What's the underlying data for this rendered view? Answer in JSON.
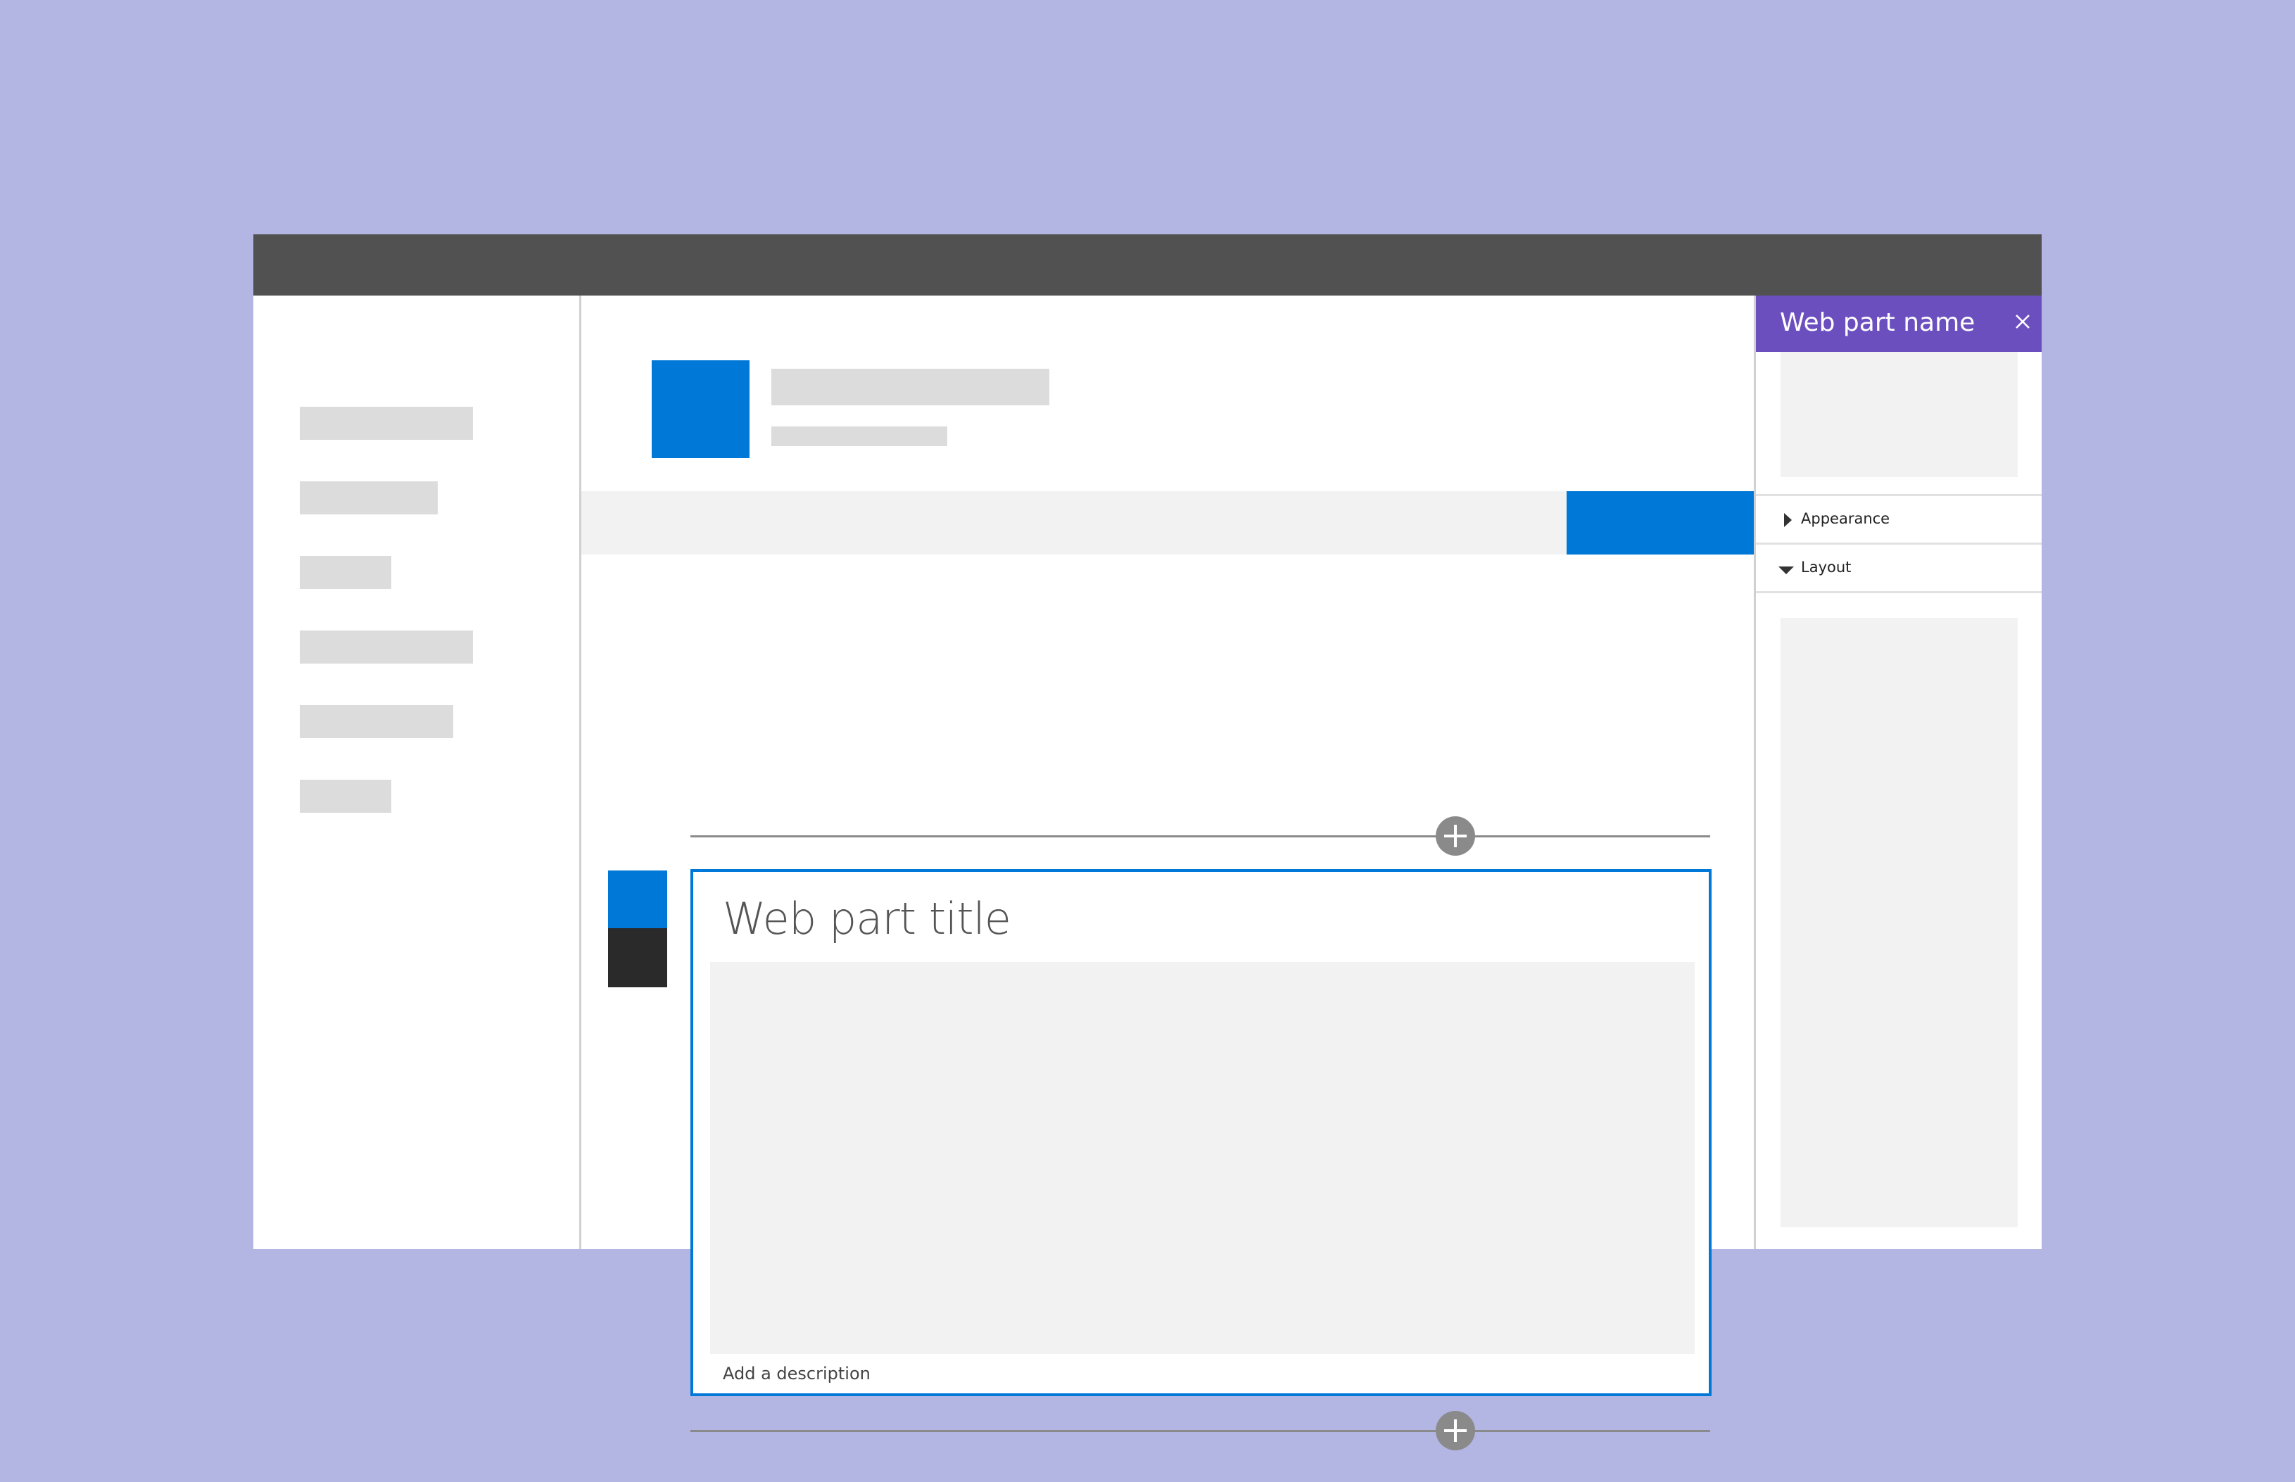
{
  "window": {
    "accent_color": "#0078d7",
    "pane_header_color": "#6b4fbf",
    "frame_color": "#515151"
  },
  "webpart": {
    "title": "Web part title",
    "description": "Add a description"
  },
  "pane": {
    "title": "Web part name",
    "close_icon": "close-icon",
    "sections": [
      {
        "label": "Appearance",
        "state": "collapsed"
      },
      {
        "label": "Layout",
        "state": "expanded"
      }
    ]
  }
}
